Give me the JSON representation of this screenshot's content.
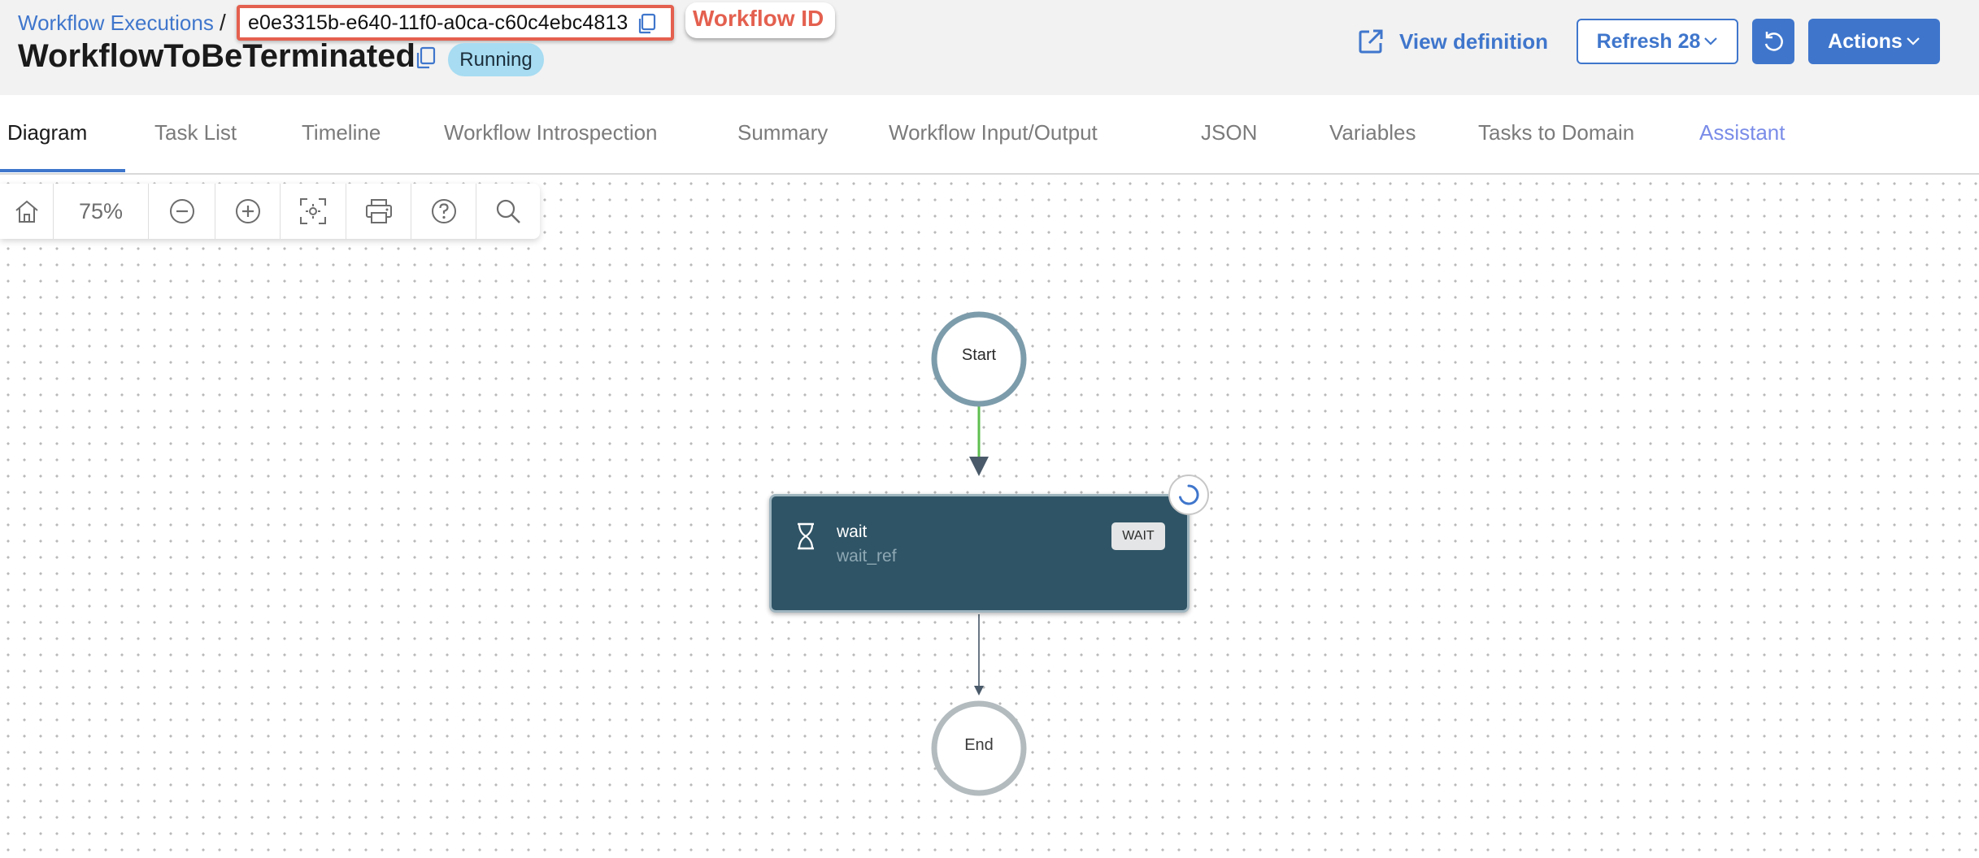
{
  "breadcrumb": {
    "parent_label": "Workflow Executions",
    "separator": "/"
  },
  "workflow": {
    "id": "e0e3315b-e640-11f0-a0ca-c60c4ebc4813",
    "id_annotation": "Workflow ID",
    "name": "WorkflowToBeTerminated",
    "status": "Running"
  },
  "header_actions": {
    "view_definition_label": "View definition",
    "refresh_label": "Refresh 28",
    "actions_label": "Actions"
  },
  "tabs": [
    {
      "label": "Diagram",
      "active": true
    },
    {
      "label": "Task List"
    },
    {
      "label": "Timeline"
    },
    {
      "label": "Workflow Introspection"
    },
    {
      "label": "Summary"
    },
    {
      "label": "Workflow Input/Output"
    },
    {
      "label": "JSON"
    },
    {
      "label": "Variables"
    },
    {
      "label": "Tasks to Domain"
    },
    {
      "label": "Assistant"
    }
  ],
  "toolbar": {
    "zoom": "75%",
    "icons": [
      "home-icon",
      "zoom-out-icon",
      "zoom-in-icon",
      "fit-view-icon",
      "print-icon",
      "help-icon",
      "search-icon"
    ]
  },
  "diagram": {
    "start_label": "Start",
    "end_label": "End",
    "task": {
      "name": "wait",
      "ref": "wait_ref",
      "type": "WAIT",
      "icon": "hourglass-icon",
      "state_icon": "loading-spinner-icon"
    }
  },
  "colors": {
    "accent": "#3f76cc",
    "annotation": "#e4604f",
    "running_badge": "#a7dcf2",
    "task_card": "#2f5466",
    "completed_edge": "#5fbf4f"
  }
}
